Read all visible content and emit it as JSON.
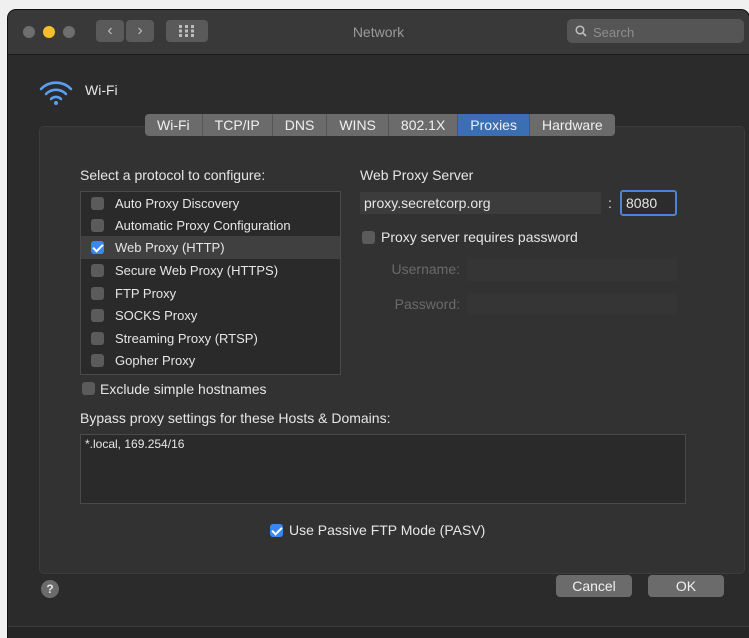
{
  "window": {
    "title": "Network"
  },
  "search": {
    "placeholder": "Search"
  },
  "interface": {
    "name": "Wi-Fi",
    "icon": "wifi-icon"
  },
  "tabs": [
    {
      "label": "Wi-Fi"
    },
    {
      "label": "TCP/IP"
    },
    {
      "label": "DNS"
    },
    {
      "label": "WINS"
    },
    {
      "label": "802.1X"
    },
    {
      "label": "Proxies",
      "active": true
    },
    {
      "label": "Hardware"
    }
  ],
  "protocols": {
    "heading": "Select a protocol to configure:",
    "items": [
      {
        "label": "Auto Proxy Discovery",
        "checked": false
      },
      {
        "label": "Automatic Proxy Configuration",
        "checked": false
      },
      {
        "label": "Web Proxy (HTTP)",
        "checked": true,
        "selected": true
      },
      {
        "label": "Secure Web Proxy (HTTPS)",
        "checked": false
      },
      {
        "label": "FTP Proxy",
        "checked": false
      },
      {
        "label": "SOCKS Proxy",
        "checked": false
      },
      {
        "label": "Streaming Proxy (RTSP)",
        "checked": false
      },
      {
        "label": "Gopher Proxy",
        "checked": false
      }
    ]
  },
  "proxy_server": {
    "heading": "Web Proxy Server",
    "host": "proxy.secretcorp.org",
    "separator": ":",
    "port": "8080",
    "requires_password_label": "Proxy server requires password",
    "requires_password": false,
    "username_label": "Username:",
    "password_label": "Password:"
  },
  "exclude_simple_hostnames": {
    "label": "Exclude simple hostnames",
    "checked": false
  },
  "bypass": {
    "heading": "Bypass proxy settings for these Hosts & Domains:",
    "value": "*.local, 169.254/16"
  },
  "passive_ftp": {
    "label": "Use Passive FTP Mode (PASV)",
    "checked": true
  },
  "buttons": {
    "help": "?",
    "cancel": "Cancel",
    "ok": "OK"
  },
  "colors": {
    "accent": "#3b86f0",
    "active_tab": "#3b6fb4",
    "window_bg": "#2b2b2b"
  }
}
